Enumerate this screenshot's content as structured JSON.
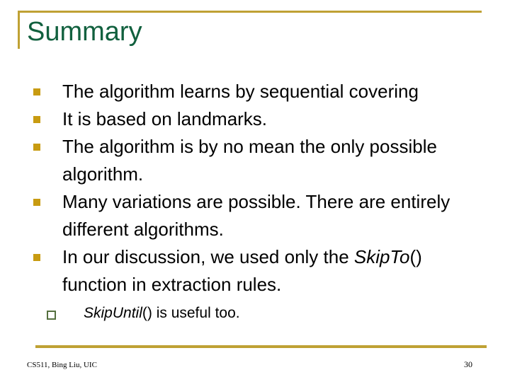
{
  "slide": {
    "title": "Summary",
    "accent_gold": "#bfa134",
    "title_green": "#11603e",
    "bullet_gold": "#c89b11",
    "subbullet_green": "#55703f",
    "background": "#ffffff"
  },
  "bullets": [
    {
      "marker": "solid-square-bullet-icon",
      "text": "The algorithm learns by sequential covering"
    },
    {
      "marker": "solid-square-bullet-icon",
      "text": "It is based on landmarks."
    },
    {
      "marker": "solid-square-bullet-icon",
      "text": "The algorithm is by no mean the only possible algorithm."
    },
    {
      "marker": "solid-square-bullet-icon",
      "text": "Many variations are possible. There are entirely different algorithms."
    },
    {
      "marker": "solid-square-bullet-icon",
      "text_pre": "In our discussion, we used only the ",
      "text_italic": "SkipTo",
      "text_post": "() function in extraction rules."
    }
  ],
  "subbullet": {
    "marker": "hollow-square-bullet-icon",
    "text_italic": "SkipUntil",
    "text_post": "() is useful too."
  },
  "footer": {
    "credit": "CS511, Bing Liu, UIC",
    "page_number": "30"
  }
}
